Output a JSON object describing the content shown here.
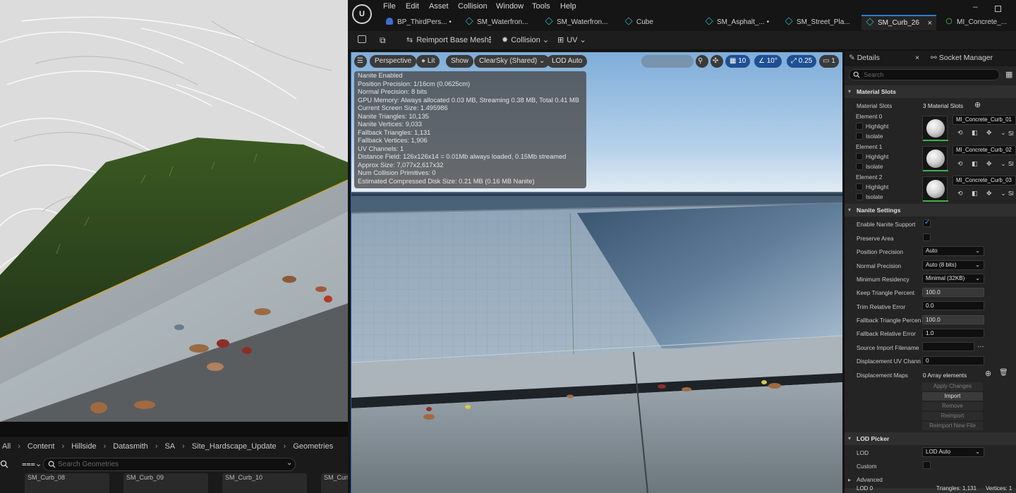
{
  "content_browser": {
    "breadcrumb": [
      "All",
      "Content",
      "Hillside",
      "Datasmith",
      "SA",
      "Site_Hardscape_Update",
      "Geometries"
    ],
    "search_placeholder": "Search Geometries",
    "assets": [
      "SM_Curb_08",
      "SM_Curb_09",
      "SM_Curb_10",
      "SM_Curb"
    ]
  },
  "menu": [
    "File",
    "Edit",
    "Asset",
    "Collision",
    "Window",
    "Tools",
    "Help"
  ],
  "logo_text": "U",
  "tabs": [
    {
      "label": "BP_ThirdPers...",
      "icon": "blueprint-icon",
      "modified": true
    },
    {
      "label": "SM_Waterfron...",
      "icon": "static-mesh-icon"
    },
    {
      "label": "SM_Waterfron...",
      "icon": "static-mesh-icon"
    },
    {
      "label": "Cube",
      "icon": "static-mesh-icon"
    },
    {
      "label": "SM_Asphalt_...",
      "icon": "static-mesh-icon",
      "modified": true
    },
    {
      "label": "SM_Street_Pla...",
      "icon": "static-mesh-icon"
    },
    {
      "label": "SM_Curb_26",
      "icon": "static-mesh-icon",
      "active": true
    },
    {
      "label": "MI_Concrete_...",
      "icon": "material-instance-icon"
    }
  ],
  "toolbar": {
    "reimport": "Reimport Base Mesh",
    "collision": "Collision",
    "uv": "UV"
  },
  "viewport": {
    "perspective": "Perspective",
    "lit": "Lit",
    "show": "Show",
    "sky": "ClearSky (Shared)",
    "lod": "LOD Auto",
    "grid_snap": "10",
    "rot_snap": "10°",
    "scale_snap": "0.25",
    "camera_speed": "1"
  },
  "stats": [
    "Nanite Enabled",
    "Position Precision: 1/16cm (0.0625cm)",
    "Normal Precision: 8 bits",
    "GPU Memory: Always allocated 0.03 MB, Streaming 0.38 MB, Total 0.41 MB",
    "Current Screen Size: 1.495986",
    "Nanite Triangles: 10,135",
    "Nanite Vertices: 9,033",
    "Fallback Triangles: 1,131",
    "Fallback Vertices: 1,906",
    "UV Channels: 1",
    "Distance Field: 126x126x14 = 0.01Mb always loaded, 0.15Mb streamed",
    "Approx Size: 7,077x2,617x32",
    "Num Collision Primitives: 0",
    "Estimated Compressed Disk Size: 0.21 MB (0.16 MB Nanite)"
  ],
  "details": {
    "tab_details": "Details",
    "tab_socket": "Socket Manager",
    "search_placeholder": "Search",
    "material_slots_header": "Material Slots",
    "material_slots_label": "Material Slots",
    "material_slots_count": "3 Material Slots",
    "highlight": "Highlight",
    "isolate": "Isolate",
    "slot_suffix": "Sl",
    "elements": [
      {
        "label": "Element 0",
        "material": "MI_Concrete_Curb_01"
      },
      {
        "label": "Element 1",
        "material": "MI_Concrete_Curb_02"
      },
      {
        "label": "Element 2",
        "material": "MI_Concrete_Curb_03"
      }
    ],
    "nanite_header": "Nanite Settings",
    "nanite": {
      "enable_label": "Enable Nanite Support",
      "preserve_label": "Preserve Area",
      "position_label": "Position Precision",
      "position_value": "Auto",
      "normal_label": "Normal Precision",
      "normal_value": "Auto (8 bits)",
      "residency_label": "Minimum Residency",
      "residency_value": "Minimal (32KB)",
      "keep_label": "Keep Triangle Percent",
      "keep_value": "100.0",
      "trim_label": "Trim Relative Error",
      "trim_value": "0.0",
      "fallback_pct_label": "Fallback Triangle Percen",
      "fallback_pct_value": "100.0",
      "fallback_err_label": "Fallback Relative Error",
      "fallback_err_value": "1.0",
      "source_label": "Source Import Filename",
      "source_value": "",
      "disp_uv_label": "Displacement UV Chann",
      "disp_uv_value": "0",
      "disp_maps_label": "Displacement Maps",
      "disp_maps_value": "0 Array elements",
      "buttons": [
        "Apply Changes",
        "Import",
        "Remove",
        "Reimport",
        "Reimport New File"
      ]
    },
    "lod_header": "LOD Picker",
    "lod_label": "LOD",
    "lod_value": "LOD Auto",
    "custom_label": "Custom",
    "advanced_label": "Advanced",
    "lod0_partial": "LOD 0",
    "triangles_partial": "Triangles: 1,131",
    "vertices_partial": "Vertices: 1"
  },
  "colors": {
    "accent": "#2f7bd8",
    "panel": "#242424",
    "background": "#151515",
    "sky": "#93bcdf",
    "check": "#4a9cff"
  }
}
